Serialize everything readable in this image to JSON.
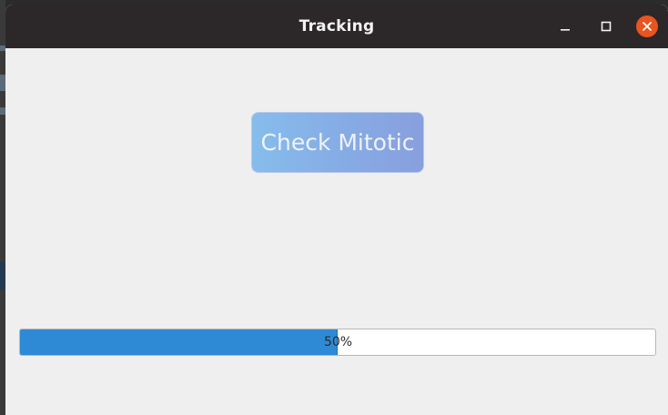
{
  "window": {
    "title": "Tracking",
    "controls": {
      "minimize_icon": "minimize-icon",
      "maximize_icon": "maximize-icon",
      "close_icon": "close-icon",
      "close_color": "#e95420"
    }
  },
  "main": {
    "check_button_label": "Check Mitotic",
    "progress": {
      "value": 50,
      "text": "50%",
      "fill_color": "#2f8ad6"
    }
  }
}
